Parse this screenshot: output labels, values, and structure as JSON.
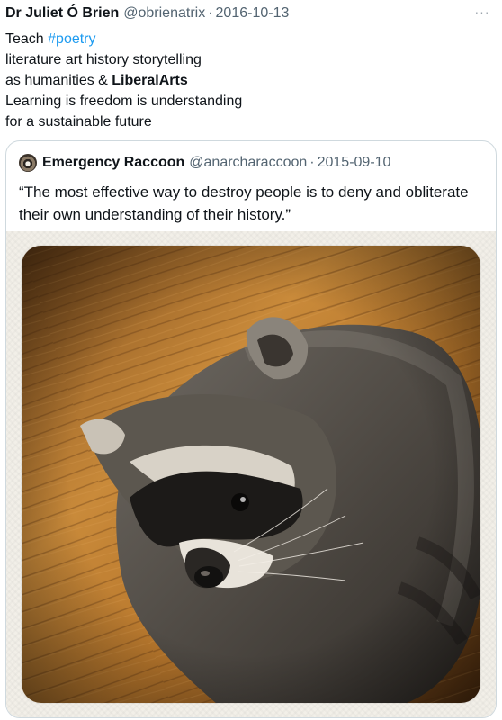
{
  "tweet": {
    "author_name": "Dr Juliet Ó Brien",
    "author_handle": "@obrienatrix",
    "separator": "·",
    "date": "2016-10-13",
    "more_glyph": "···",
    "lines": {
      "l1_prefix": "Teach ",
      "l1_hashtag": "#poetry",
      "l2": "literature art history storytelling",
      "l3_prefix": "as humanities & ",
      "l3_bold": "LiberalArts",
      "l4": "Learning is freedom is understanding",
      "l5": "for a sustainable future"
    }
  },
  "quote": {
    "author_name": "Emergency Raccoon",
    "author_handle": "@anarcharaccoon",
    "separator": "·",
    "date": "2015-09-10",
    "text_line1": "“The most effective way to destroy people is to deny and obliterate",
    "text_line2": "their own understanding of their history.”",
    "image_alt": "raccoon-photo"
  },
  "colors": {
    "text": "#0f1419",
    "secondary": "#536471",
    "link": "#1d9bf0",
    "border": "#cfd9de"
  }
}
